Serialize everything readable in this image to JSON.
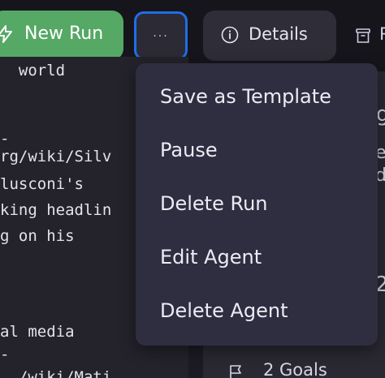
{
  "toolbar": {
    "new_run_label": "New Run",
    "more_label": "···",
    "details_label": "Details",
    "right_partial_label": "R"
  },
  "log": {
    "lines": [
      "  world",
      "",
      "",
      "-",
      "rg/wiki/Silv",
      "lusconi's",
      "king headlin",
      "g on his",
      "",
      "",
      "",
      "al media",
      "-",
      "  /wiki/Mati"
    ]
  },
  "side_panel": {
    "frag_1": "g",
    "frag_2": "e",
    "frag_3": "d",
    "frag_4": "2",
    "goals_label": "2 Goals"
  },
  "menu": {
    "items": [
      "Save as Template",
      "Pause",
      "Delete Run",
      "Edit Agent",
      "Delete Agent"
    ]
  }
}
